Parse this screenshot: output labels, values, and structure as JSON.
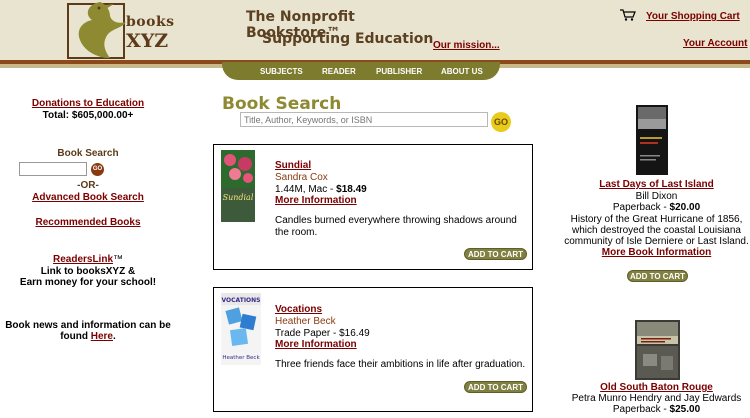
{
  "header": {
    "logo_text_top": "books",
    "logo_text_bottom": "XYZ",
    "tagline_1": "The Nonprofit Bookstore™",
    "tagline_2": "Supporting Education",
    "mission_link": "Our mission...",
    "cart_link": "Your Shopping Cart",
    "account_link": "Your Account"
  },
  "nav": {
    "items": [
      "SUBJECTS",
      "READER",
      "PUBLISHER",
      "ABOUT US"
    ]
  },
  "left": {
    "donations_link": "Donations to Education",
    "donations_total": "Total: $605,000.00+",
    "search_title": "Book Search",
    "search_go": "GO",
    "or_text": "-OR-",
    "advanced_link": "Advanced Book Search",
    "recommended_link": "Recommended Books",
    "readerslink_title": "ReadersLink",
    "readerslink_tm": "™",
    "readerslink_line1": "Link to booksXYZ &",
    "readerslink_line2": "Earn money for your school!",
    "news_line1": "Book news and information can be",
    "news_line2_prefix": "found ",
    "news_link": "Here",
    "news_suffix": "."
  },
  "main": {
    "title": "Book Search",
    "search_placeholder": "Title, Author, Keywords, or ISBN",
    "go_label": "GO",
    "books": [
      {
        "title": "Sundial",
        "author": "Sandra Cox",
        "format": "1.44M, Mac - ",
        "price": "$18.49",
        "more": "More Information",
        "description": "Candles burned everywhere throwing shadows around the room.",
        "cover_text": "Sundial",
        "add_to_cart": "ADD TO CART"
      },
      {
        "title": "Vocations",
        "author": "Heather Beck",
        "format": "Trade Paper - ",
        "price": "$16.49",
        "more": "More Information",
        "description": "Three friends face their ambitions in life after graduation.",
        "cover_text": "VOCATIONS",
        "cover_author": "Heather Beck",
        "add_to_cart": "ADD TO CART"
      }
    ]
  },
  "right": {
    "books": [
      {
        "title": "Last Days of Last Island",
        "author": "Bill Dixon",
        "format": "Paperback - ",
        "price": "$20.00",
        "desc_1": "History of the Great Hurricane of 1856,",
        "desc_2": "which destroyed the coastal Louisiana",
        "desc_3": "community of Isle Derniere or Last Island.",
        "more": "More Book Information",
        "add_to_cart": "ADD TO CART"
      },
      {
        "title": "Old South Baton Rouge",
        "author": "Petra Munro Hendry and Jay Edwards",
        "format": "Paperback - ",
        "price": "$25.00"
      }
    ]
  },
  "colors": {
    "link": "#7a0000",
    "header_bg": "#e9e4d0",
    "nav_bg": "#7d7b2d",
    "title_olive": "#8e8a32",
    "go_yellow": "#e9cb1e"
  }
}
